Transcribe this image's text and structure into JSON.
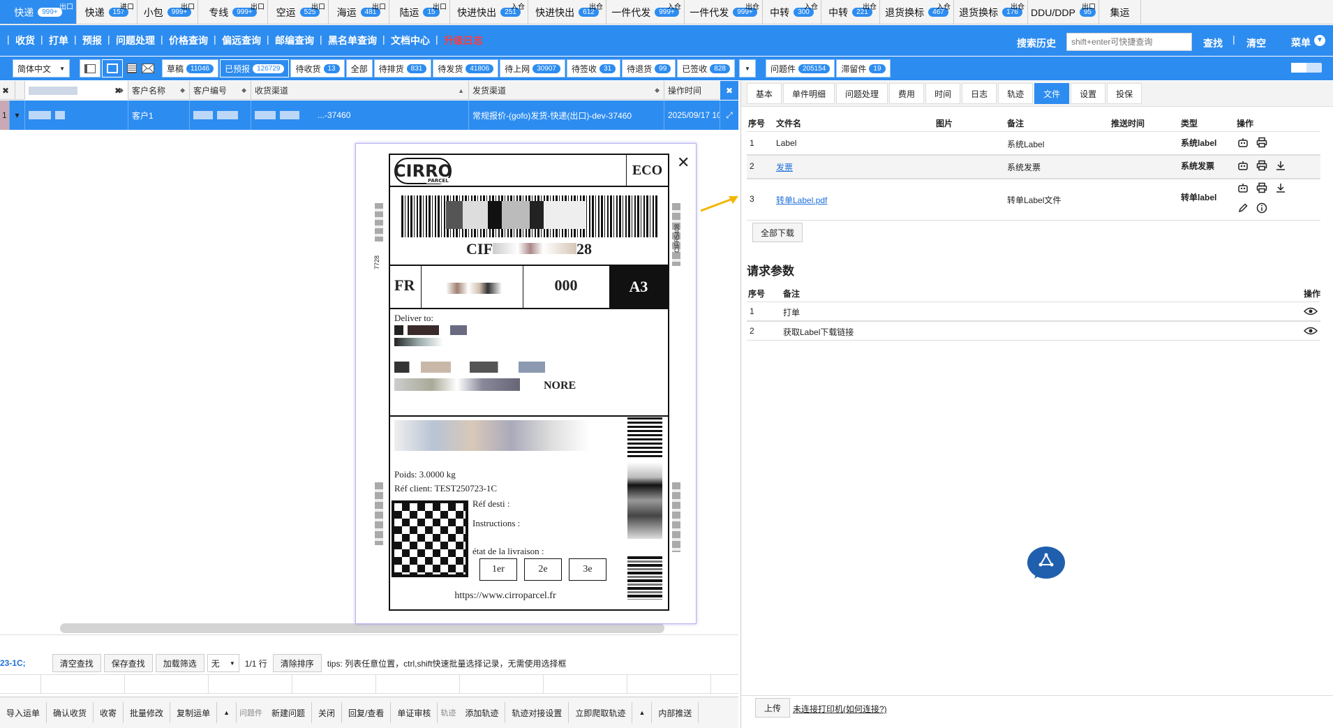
{
  "top_tabs": [
    {
      "label": "快递",
      "badge": "999+",
      "corner": "出口",
      "active": true
    },
    {
      "label": "快递",
      "badge": "157",
      "corner": "进口"
    },
    {
      "label": "小包",
      "badge": "999+",
      "corner": "出口"
    },
    {
      "label": "专线",
      "badge": "999+",
      "corner": "出口"
    },
    {
      "label": "空运",
      "badge": "525",
      "corner": "出口"
    },
    {
      "label": "海运",
      "badge": "481",
      "corner": "出口"
    },
    {
      "label": "陆运",
      "badge": "15",
      "corner": "出口"
    },
    {
      "label": "快进快出",
      "badge": "251",
      "corner": "入仓"
    },
    {
      "label": "快进快出",
      "badge": "612",
      "corner": "出仓"
    },
    {
      "label": "一件代发",
      "badge": "999+",
      "corner": "入仓"
    },
    {
      "label": "一件代发",
      "badge": "999+",
      "corner": "出仓"
    },
    {
      "label": "中转",
      "badge": "300",
      "corner": "入仓"
    },
    {
      "label": "中转",
      "badge": "221",
      "corner": "出仓"
    },
    {
      "label": "退货换标",
      "badge": "467",
      "corner": "入仓"
    },
    {
      "label": "退货换标",
      "badge": "176",
      "corner": "出仓"
    },
    {
      "label": "DDU/DDP",
      "badge": "95",
      "corner": "出口"
    },
    {
      "label": "集运",
      "badge": "",
      "corner": ""
    }
  ],
  "nav": {
    "items": [
      "收货",
      "打单",
      "预报",
      "问题处理",
      "价格查询",
      "偏远查询",
      "邮编查询",
      "黑名单查询",
      "文档中心",
      "升级日志"
    ],
    "search_history": "搜索历史",
    "search_placeholder": "shift+enter可快捷查询",
    "find": "查找",
    "clear": "清空",
    "menu": "菜单"
  },
  "filters": {
    "language": "简体中文",
    "statuses": [
      {
        "label": "草稿",
        "badge": "11046"
      },
      {
        "label": "已预报",
        "badge": "126729",
        "on": true
      },
      {
        "label": "待收货",
        "badge": "13"
      },
      {
        "label": "全部",
        "badge": ""
      },
      {
        "label": "待排货",
        "badge": "831"
      },
      {
        "label": "待发货",
        "badge": "41806"
      },
      {
        "label": "待上网",
        "badge": "30907"
      },
      {
        "label": "待签收",
        "badge": "31"
      },
      {
        "label": "待退货",
        "badge": "99"
      },
      {
        "label": "已签收",
        "badge": "828"
      }
    ],
    "extra": [
      {
        "label": "问题件",
        "badge": "205154"
      },
      {
        "label": "滞留件",
        "badge": "19"
      }
    ]
  },
  "grid": {
    "columns": [
      "客户名称",
      "客户编号",
      "收货渠道",
      "发货渠道",
      "操作时间"
    ],
    "row": {
      "index": "1",
      "customer_name": "客户1",
      "receive_channel": "...-37460",
      "ship_channel": "常规报价-(gofo)发货-快递(出口)-dev-37460",
      "op_time": "2025/09/17 10:"
    }
  },
  "label": {
    "brand": "CIRRO",
    "brand_sub": "PARCEL",
    "service": "ECO",
    "tracking": "CIF",
    "tracking_tail": "28",
    "country": "FR",
    "zone": "000",
    "sort_code": "A3",
    "deliver_to": "Deliver to:",
    "addr_tail": "NORE",
    "weight": "Poids: 3.0000 kg",
    "ref_client": "Réf client: TEST250723-1C",
    "ref_desti": "Réf desti :",
    "instructions": "Instructions :",
    "etat": "état de la livraison :",
    "attempts": [
      "1er",
      "2e",
      "3e"
    ],
    "url": "https://www.cirroparcel.fr",
    "side_left": "7728",
    "side_right": "CIFR5408"
  },
  "right": {
    "tabs": [
      "基本",
      "单件明细",
      "问题处理",
      "费用",
      "时间",
      "日志",
      "轨迹",
      "文件",
      "设置",
      "投保"
    ],
    "active_tab": "文件",
    "files_header": [
      "序号",
      "文件名",
      "图片",
      "备注",
      "推送时间",
      "类型",
      "操作"
    ],
    "files": [
      {
        "no": "1",
        "name": "Label",
        "note": "系统Label",
        "type": "系统label",
        "link": false
      },
      {
        "no": "2",
        "name": "发票",
        "note": "系统发票",
        "type": "系统发票",
        "link": true
      },
      {
        "no": "3",
        "name": "转单Label.pdf",
        "note": "转单Label文件",
        "type": "转单label",
        "link": true
      }
    ],
    "download_all": "全部下载",
    "params_title": "请求参数",
    "params_header": [
      "序号",
      "备注",
      "操作"
    ],
    "params": [
      {
        "no": "1",
        "note": "打单"
      },
      {
        "no": "2",
        "note": "获取Label下载链接"
      }
    ],
    "upload": "上传",
    "printer_status": "未连接打印机(如何连接?)"
  },
  "bottom": {
    "query_text": "23-1C;",
    "buttons1": [
      "清空查找",
      "保存查找",
      "加载筛选"
    ],
    "select_value": "无",
    "row_count": "1/1 行",
    "clear_sort": "清除排序",
    "tips": "tips: 列表任意位置，ctrl,shift快速批量选择记录，无需使用选择框",
    "bar2": [
      {
        "t": "btn",
        "label": "导入运单"
      },
      {
        "t": "btn",
        "label": "确认收货"
      },
      {
        "t": "btn",
        "label": "收寄"
      },
      {
        "t": "btn",
        "label": "批量修改"
      },
      {
        "t": "btn",
        "label": "复制运单"
      },
      {
        "t": "arrow",
        "label": "▲"
      },
      {
        "t": "lbl",
        "label": "问题件"
      },
      {
        "t": "btn",
        "label": "新建问题"
      },
      {
        "t": "btn",
        "label": "关闭"
      },
      {
        "t": "btn",
        "label": "回复/查看"
      },
      {
        "t": "btn",
        "label": "单证审核"
      },
      {
        "t": "lbl",
        "label": "轨迹"
      },
      {
        "t": "btn",
        "label": "添加轨迹"
      },
      {
        "t": "btn",
        "label": "轨迹对接设置"
      },
      {
        "t": "btn",
        "label": "立即爬取轨迹"
      },
      {
        "t": "arrow",
        "label": "▲"
      },
      {
        "t": "btn",
        "label": "内部推送"
      }
    ]
  },
  "colors": {
    "primary": "#2d8cf0",
    "upgrade": "#ff3b3b",
    "link": "#1e6fd9",
    "arrow": "#f2b705"
  }
}
